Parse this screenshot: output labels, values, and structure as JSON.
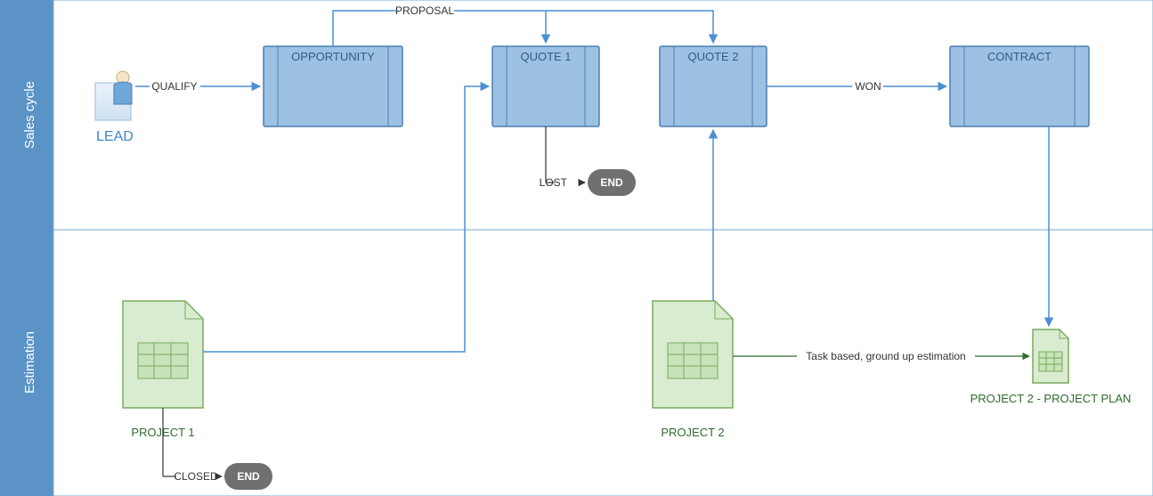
{
  "lanes": {
    "sales": "Sales cycle",
    "estimation": "Estimation"
  },
  "nodes": {
    "lead": "LEAD",
    "opportunity": "OPPORTUNITY",
    "quote1": "QUOTE 1",
    "quote2": "QUOTE 2",
    "contract": "CONTRACT",
    "end1": "END",
    "end2": "END",
    "project1": "PROJECT 1",
    "project2": "PROJECT 2",
    "project2plan": "PROJECT 2 - PROJECT PLAN"
  },
  "edges": {
    "qualify": "QUALIFY",
    "proposal": "PROPOSAL",
    "lost": "LOST",
    "won": "WON",
    "closed": "CLOSED",
    "taskbased": "Task based, ground up estimation"
  },
  "colors": {
    "laneHeader": "#5b93c6",
    "laneBorder": "#7aa7d1",
    "boxFill": "#9dc1e2",
    "boxStroke": "#4a7fb3",
    "blueLine": "#4a8fd3",
    "greenFill": "#d9ecd0",
    "greenStroke": "#7aaa5e",
    "endFill": "#6f6f6f",
    "darkLine": "#333"
  }
}
